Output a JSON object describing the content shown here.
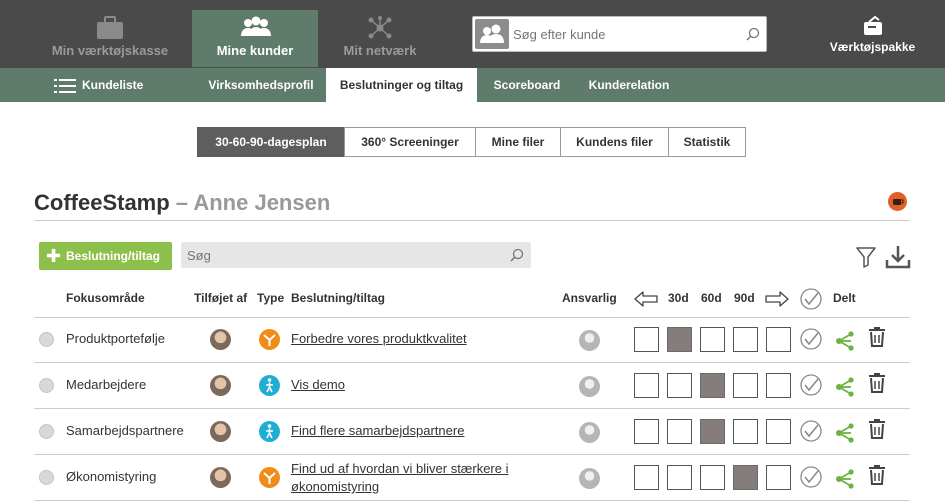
{
  "topnav": [
    {
      "label": "Min værktøjskasse",
      "icon": "toolbox-icon",
      "active": false
    },
    {
      "label": "Mine kunder",
      "icon": "customers-icon",
      "active": true
    },
    {
      "label": "Mit netværk",
      "icon": "network-icon",
      "active": false
    }
  ],
  "search": {
    "placeholder": "Søg efter kunde"
  },
  "toolkit": {
    "label": "Værktøjspakke",
    "icon": "toolkit-package-icon"
  },
  "subnav": {
    "customer_list": "Kundeliste",
    "tabs": [
      "Virksomhedsprofil",
      "Beslutninger og tiltag",
      "Scoreboard",
      "Kunderelation"
    ],
    "active_tab": "Beslutninger og tiltag"
  },
  "segments": [
    "30-60-90-dagesplan",
    "360° Screeninger",
    "Mine filer",
    "Kundens filer",
    "Statistik"
  ],
  "active_segment": "30-60-90-dagesplan",
  "page": {
    "company": "CoffeeStamp",
    "separator": " – ",
    "contact": "Anne Jensen"
  },
  "toolbar": {
    "add_label": "Beslutning/tiltag",
    "search_placeholder": "Søg"
  },
  "columns": {
    "focus": "Fokusområde",
    "added_by": "Tilføjet af",
    "type": "Type",
    "action": "Beslutning/tiltag",
    "responsible": "Ansvarlig",
    "d30": "30d",
    "d60": "60d",
    "d90": "90d",
    "shared": "Delt"
  },
  "rows": [
    {
      "focus": "Produktportefølje",
      "type": "strategy",
      "action": "Forbedre vores produktkvalitet",
      "checked_box": 1
    },
    {
      "focus": "Medarbejdere",
      "type": "walking",
      "action": "Vis demo",
      "checked_box": 2
    },
    {
      "focus": "Samarbejdspartnere",
      "type": "walking",
      "action": "Find flere samarbejdspartnere",
      "checked_box": 2
    },
    {
      "focus": "Økonomistyring",
      "type": "strategy",
      "action": "Find ud af hvordan vi bliver stærkere i økonomistyring",
      "checked_box": 3
    }
  ],
  "colors": {
    "topbar": "#4a4a4a",
    "accent": "#5e7b6c",
    "add_button": "#8dc04a",
    "type_strategy": "#f08c1a",
    "type_walking": "#1eaed4",
    "filled_box": "#857d7b",
    "share": "#6cb33f"
  }
}
